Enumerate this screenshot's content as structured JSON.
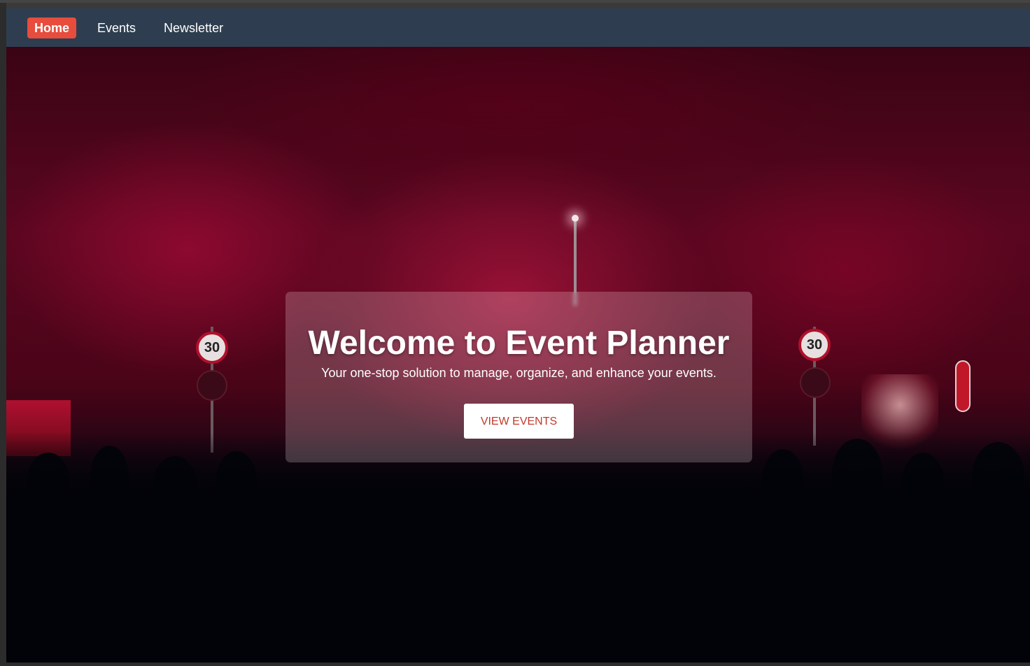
{
  "nav": {
    "items": [
      {
        "label": "Home",
        "active": true
      },
      {
        "label": "Events",
        "active": false
      },
      {
        "label": "Newsletter",
        "active": false
      }
    ]
  },
  "hero": {
    "title": "Welcome to Event Planner",
    "subtitle": "Your one-stop solution to manage, organize, and enhance your events.",
    "button_label": "VIEW EVENTS",
    "sign_left": "30",
    "sign_right": "30"
  },
  "colors": {
    "navbar": "#2e3e50",
    "active_nav": "#e74c3c",
    "button_text": "#c0392b"
  }
}
